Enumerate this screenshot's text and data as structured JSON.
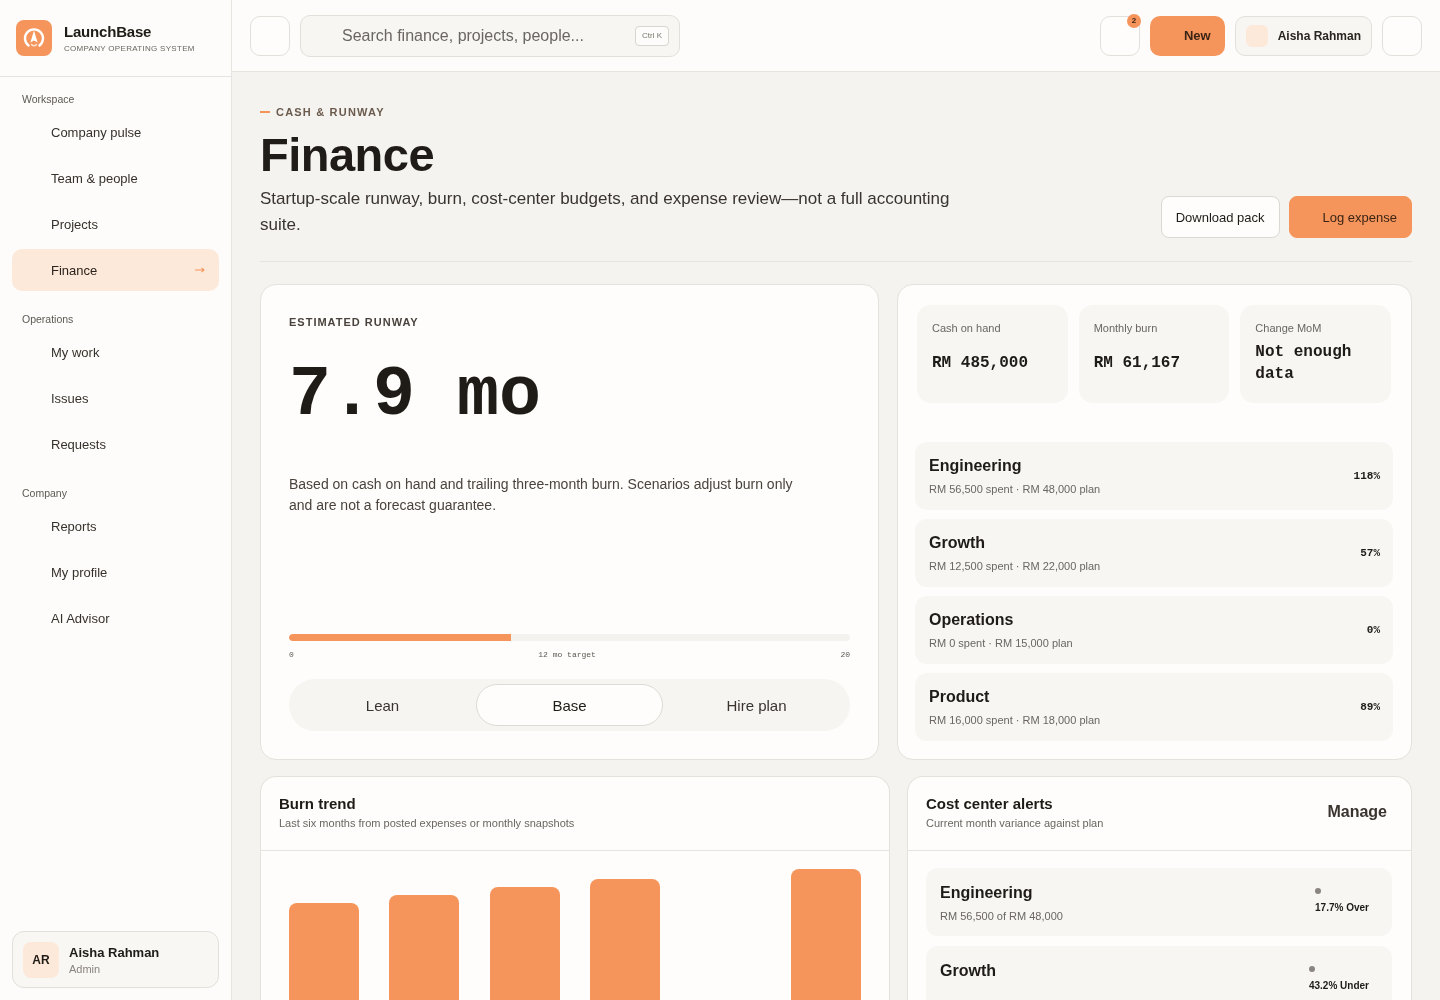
{
  "brand": {
    "name": "LaunchBase",
    "tagline": "COMPANY OPERATING SYSTEM"
  },
  "sidebar": {
    "sections": [
      {
        "label": "Workspace",
        "items": [
          {
            "label": "Company pulse",
            "selected": false
          },
          {
            "label": "Team & people",
            "selected": false
          },
          {
            "label": "Projects",
            "selected": false
          },
          {
            "label": "Finance",
            "selected": true
          }
        ]
      },
      {
        "label": "Operations",
        "items": [
          {
            "label": "My work",
            "selected": false
          },
          {
            "label": "Issues",
            "selected": false
          },
          {
            "label": "Requests",
            "selected": false
          }
        ]
      },
      {
        "label": "Company",
        "items": [
          {
            "label": "Reports",
            "selected": false
          },
          {
            "label": "My profile",
            "selected": false
          },
          {
            "label": "AI Advisor",
            "selected": false
          }
        ]
      }
    ],
    "user": {
      "initials": "AR",
      "name": "Aisha Rahman",
      "role": "Admin"
    }
  },
  "topbar": {
    "search": {
      "placeholder": "Search finance, projects, people...",
      "shortcut": "Ctrl K"
    },
    "notifications": {
      "count": "2"
    },
    "new_button": "New",
    "user_name": "Aisha Rahman"
  },
  "header": {
    "eyebrow": "CASH & RUNWAY",
    "title": "Finance",
    "description": "Startup-scale runway, burn, cost-center budgets, and expense review—not a full accounting suite.",
    "buttons": [
      {
        "label": "Download pack",
        "kind": "secondary"
      },
      {
        "label": "Log expense",
        "kind": "primary"
      }
    ]
  },
  "runway": {
    "label": "ESTIMATED RUNWAY",
    "value": "7.9 mo",
    "note": "Based on cash on hand and trailing three-month burn. Scenarios adjust burn only and are not a forecast guarantee.",
    "progress": {
      "level": 0.395,
      "scale": [
        "0",
        "12 mo target",
        "20"
      ]
    },
    "scenarios": [
      {
        "label": "Lean",
        "selected": false
      },
      {
        "label": "Base",
        "selected": true
      },
      {
        "label": "Hire plan",
        "selected": false
      }
    ]
  },
  "summary": {
    "stats": [
      {
        "label": "Cash on hand",
        "value": "RM 485,000"
      },
      {
        "label": "Monthly burn",
        "value": "RM 61,167"
      },
      {
        "label": "Change MoM",
        "value": "Not enough data"
      }
    ],
    "cost_centers": [
      {
        "name": "Engineering",
        "detail": "RM 56,500 spent · RM 48,000 plan",
        "percent": "118%"
      },
      {
        "name": "Growth",
        "detail": "RM 12,500 spent · RM 22,000 plan",
        "percent": "57%"
      },
      {
        "name": "Operations",
        "detail": "RM 0 spent · RM 15,000 plan",
        "percent": "0%"
      },
      {
        "name": "Product",
        "detail": "RM 16,000 spent · RM 18,000 plan",
        "percent": "89%"
      }
    ]
  },
  "burn_trend": {
    "title": "Burn trend",
    "subtitle": "Last six months from posted expenses or monthly snapshots"
  },
  "alerts": {
    "title": "Cost center alerts",
    "subtitle": "Current month variance against plan",
    "action": "Manage",
    "items": [
      {
        "name": "Engineering",
        "detail": "RM 56,500 of RM 48,000",
        "status": "17.7% Over"
      },
      {
        "name": "Growth",
        "status": "43.2% Under"
      }
    ]
  }
}
